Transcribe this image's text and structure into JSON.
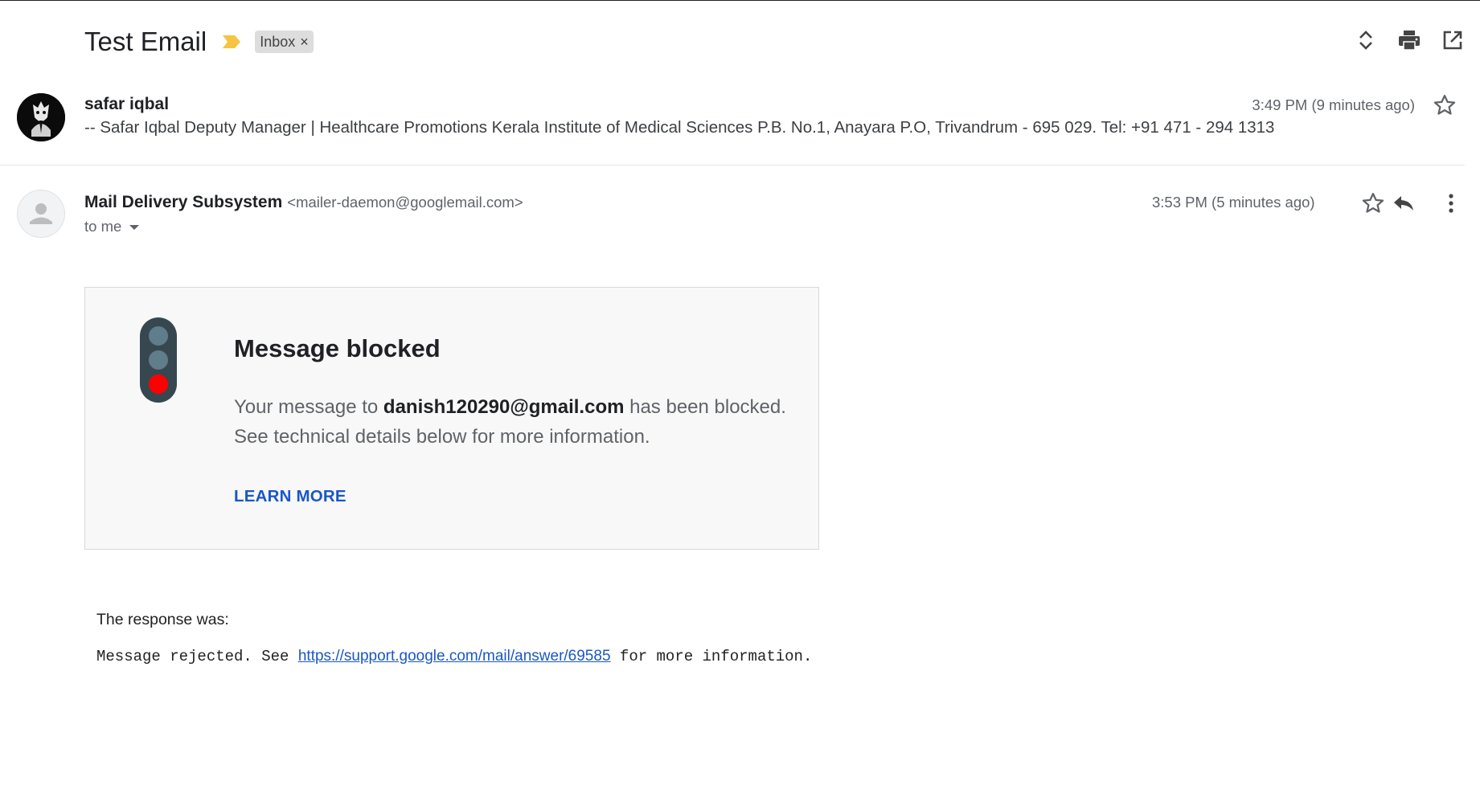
{
  "thread": {
    "subject": "Test Email",
    "label": "Inbox",
    "label_remove": "×",
    "icons": [
      "expand-all-icon",
      "print-icon",
      "open-new-window-icon"
    ]
  },
  "message1": {
    "sender": "safar iqbal",
    "snippet": "-- Safar Iqbal Deputy Manager | Healthcare Promotions Kerala Institute of Medical Sciences P.B. No.1, Anayara P.O, Trivandrum - 695 029. Tel: +91 471 - 294 1313",
    "time": "3:49 PM (9 minutes ago)"
  },
  "message2": {
    "sender": "Mail Delivery Subsystem",
    "sender_email": "<mailer-daemon@googlemail.com>",
    "recipient": "to me",
    "time": "3:53 PM (5 minutes ago)",
    "bounce": {
      "title": "Message blocked",
      "text_before": "Your message to ",
      "address": "danish120290@gmail.com",
      "text_after": " has been blocked. See technical details below for more information.",
      "learn_more": "LEARN MORE"
    },
    "response_label": "The response was:",
    "response_prefix": "Message rejected. See ",
    "response_link": "https://support.google.com/mail/answer/69585",
    "response_suffix": " for more information."
  },
  "colors": {
    "accent_link": "#1a57c5",
    "important_marker": "#f6c342",
    "traffic_light_red": "#ff0000",
    "traffic_light_body": "#37474f"
  }
}
